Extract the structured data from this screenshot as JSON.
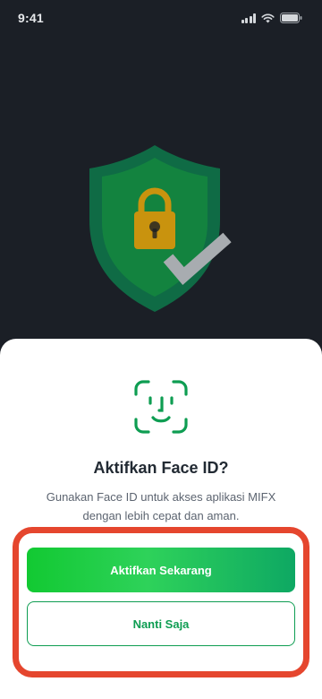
{
  "status_bar": {
    "time": "9:41",
    "icons": [
      "signal-icon",
      "wifi-icon",
      "battery-icon"
    ]
  },
  "hero": {
    "icon": "shield-lock-check-illustration",
    "colors": {
      "shield_outer": "#0f6b45",
      "shield_inner": "#13833f",
      "lock": "#c9930e",
      "check": "#a8acb0"
    }
  },
  "sheet": {
    "icon": "face-id-icon",
    "title": "Aktifkan Face ID?",
    "description": "Gunakan Face ID untuk akses aplikasi MIFX dengan lebih cepat dan aman.",
    "primary_button": "Aktifkan Sekarang",
    "secondary_button": "Nanti Saja"
  },
  "colors": {
    "background": "#1b1f26",
    "accent_green": "#0e9d52",
    "highlight_red": "#e5462e"
  }
}
